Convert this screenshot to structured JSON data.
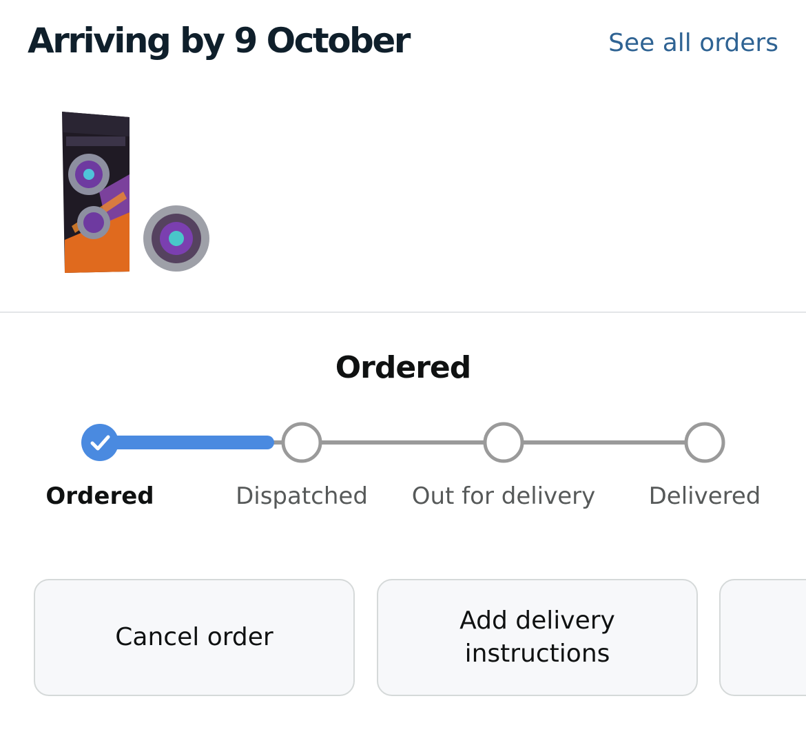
{
  "header": {
    "title": "Arriving by 9 October",
    "see_all_orders": "See all orders"
  },
  "product": {
    "image_alt": "Beyblade X product"
  },
  "status": {
    "heading": "Ordered",
    "progress_completed_steps": 1,
    "steps": [
      {
        "label": "Ordered",
        "state": "complete"
      },
      {
        "label": "Dispatched",
        "state": "pending"
      },
      {
        "label": "Out for delivery",
        "state": "pending"
      },
      {
        "label": "Delivered",
        "state": "pending"
      }
    ]
  },
  "actions": {
    "cancel_order": "Cancel order",
    "add_delivery_instructions": "Add delivery\ninstructions"
  },
  "colors": {
    "accent": "#4a8ae0",
    "link": "#2f6393",
    "track_pending": "#9a9a9a"
  }
}
